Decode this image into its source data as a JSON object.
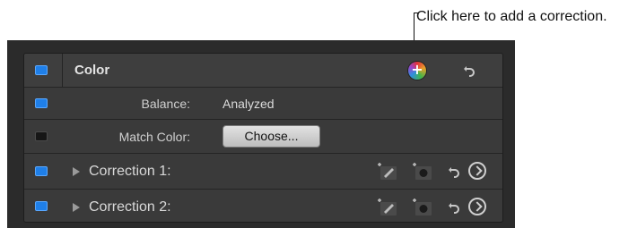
{
  "callout": {
    "text": "Click here to add a correction."
  },
  "panel": {
    "header": {
      "title": "Color",
      "enabled": true
    },
    "rows": [
      {
        "label": "Balance:",
        "value": "Analyzed",
        "enabled": true
      },
      {
        "label": "Match Color:",
        "button_label": "Choose...",
        "enabled": false
      },
      {
        "label": "Correction 1:",
        "enabled": true
      },
      {
        "label": "Correction 2:",
        "enabled": true
      }
    ]
  },
  "colors": {
    "checkbox_on": "#1f7fe8",
    "panel_bg": "#3a3a3a",
    "outer_bg": "#2b2b2b"
  },
  "icons": {
    "add": "add-correction-icon",
    "reset": "reset-icon",
    "mask": "color-mask-icon",
    "shape": "shape-mask-icon",
    "goto": "go-to-arrow-icon"
  }
}
